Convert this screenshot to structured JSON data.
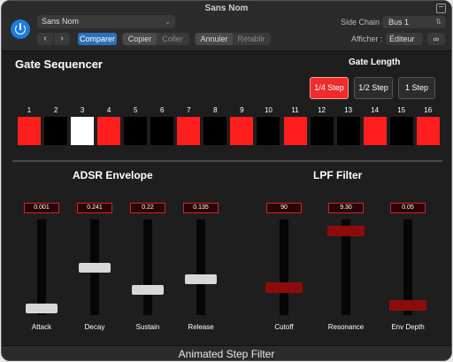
{
  "window": {
    "title": "Sans Nom"
  },
  "header": {
    "preset": "Sans Nom",
    "prev": "‹",
    "next": "›",
    "compare": "Comparer",
    "copy": "Copier",
    "paste": "Coller",
    "undo": "Annuler",
    "redo": "Rétablir",
    "side_chain_label": "Side Chain :",
    "side_chain_value": "Bus 1",
    "view_label": "Afficher :",
    "view_value": "Éditeur"
  },
  "sequencer": {
    "title": "Gate Sequencer",
    "gate_length_title": "Gate Length",
    "gate_lengths": [
      "1/4 Step",
      "1/2 Step",
      "1 Step"
    ],
    "active_gate_length": "1/4 Step",
    "steps": [
      {
        "n": "1",
        "state": "on"
      },
      {
        "n": "2",
        "state": "off"
      },
      {
        "n": "3",
        "state": "current"
      },
      {
        "n": "4",
        "state": "on"
      },
      {
        "n": "5",
        "state": "off"
      },
      {
        "n": "6",
        "state": "off"
      },
      {
        "n": "7",
        "state": "on"
      },
      {
        "n": "8",
        "state": "off"
      },
      {
        "n": "9",
        "state": "on"
      },
      {
        "n": "10",
        "state": "off"
      },
      {
        "n": "11",
        "state": "on"
      },
      {
        "n": "12",
        "state": "off"
      },
      {
        "n": "13",
        "state": "off"
      },
      {
        "n": "14",
        "state": "on"
      },
      {
        "n": "15",
        "state": "off"
      },
      {
        "n": "16",
        "state": "on"
      }
    ]
  },
  "adsr": {
    "title": "ADSR Envelope",
    "sliders": [
      {
        "label": "Attack",
        "value": "0.001",
        "level": 0.02
      },
      {
        "label": "Decay",
        "value": "0.241",
        "level": 0.5
      },
      {
        "label": "Sustain",
        "value": "0.22",
        "level": 0.24
      },
      {
        "label": "Release",
        "value": "0.135",
        "level": 0.36
      }
    ]
  },
  "filter": {
    "title": "LPF Filter",
    "sliders": [
      {
        "label": "Cutoff",
        "value": "90",
        "level": 0.26
      },
      {
        "label": "Resonance",
        "value": "9.30",
        "level": 0.93
      },
      {
        "label": "Env Depth",
        "value": "0.05",
        "level": 0.05
      }
    ]
  },
  "footer": {
    "title": "Animated Step Filter"
  },
  "colors": {
    "accent": "#1e7be0",
    "step_on": "#ff1e1e",
    "step_off": "#000000",
    "step_current": "#ffffff",
    "filter_thumb": "#8c0c0c",
    "adsr_thumb": "#d8d8d8"
  }
}
